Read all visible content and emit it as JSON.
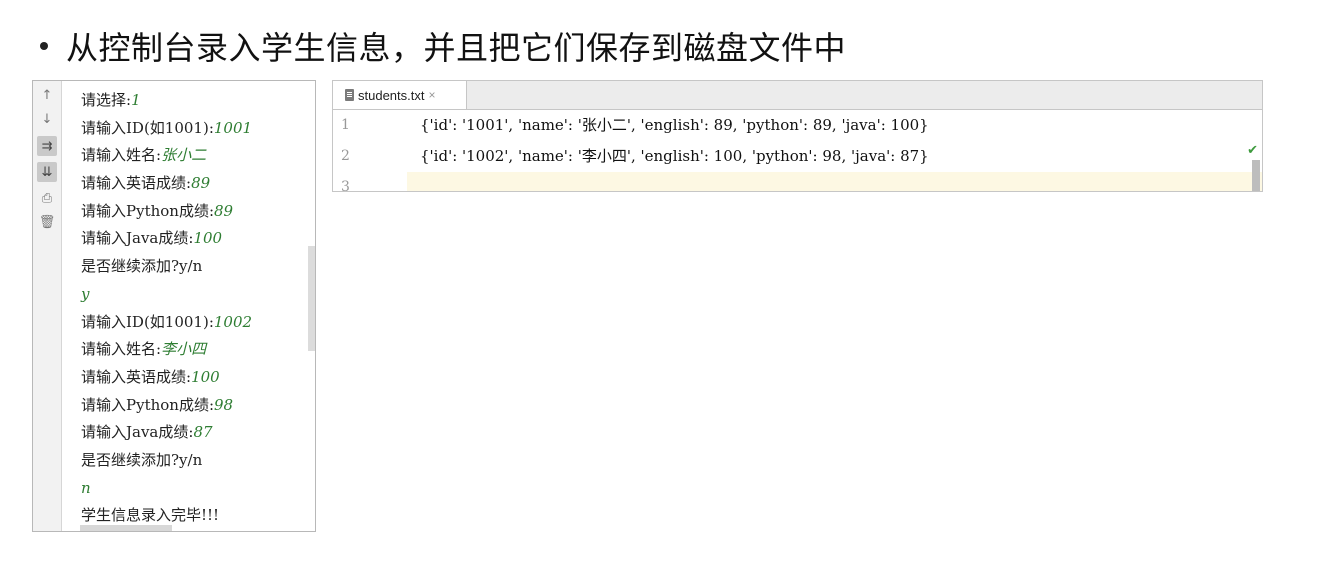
{
  "slide": {
    "title": "从控制台录入学生信息，并且把它们保存到磁盘文件中"
  },
  "console": {
    "toolbar": [
      {
        "name": "up-arrow-icon",
        "glyph": "↑"
      },
      {
        "name": "down-arrow-icon",
        "glyph": "↓"
      },
      {
        "name": "soft-wrap-icon",
        "glyph": "⇉"
      },
      {
        "name": "scroll-to-end-icon",
        "glyph": "⇊"
      },
      {
        "name": "print-icon",
        "glyph": "⎙"
      },
      {
        "name": "trash-icon",
        "glyph": "🗑"
      }
    ],
    "lines": [
      {
        "prompt": "请选择:",
        "input": "1"
      },
      {
        "prompt": "请输入ID(如1001):",
        "input": "1001"
      },
      {
        "prompt": "请输入姓名:",
        "input": "张小二"
      },
      {
        "prompt": "请输入英语成绩:",
        "input": "89"
      },
      {
        "prompt": "请输入Python成绩:",
        "input": "89"
      },
      {
        "prompt": "请输入Java成绩:",
        "input": "100"
      },
      {
        "prompt": "是否继续添加?y/n",
        "input": ""
      },
      {
        "prompt": "",
        "input": "y"
      },
      {
        "prompt": "请输入ID(如1001):",
        "input": "1002"
      },
      {
        "prompt": "请输入姓名:",
        "input": "李小四"
      },
      {
        "prompt": "请输入英语成绩:",
        "input": "100"
      },
      {
        "prompt": "请输入Python成绩:",
        "input": "98"
      },
      {
        "prompt": "请输入Java成绩:",
        "input": "87"
      },
      {
        "prompt": "是否继续添加?y/n",
        "input": ""
      },
      {
        "prompt": "",
        "input": "n"
      },
      {
        "prompt": "学生信息录入完毕!!!",
        "input": ""
      }
    ]
  },
  "editor": {
    "tab_label": "students.txt",
    "tab_close": "×",
    "lines": [
      {
        "num": "1",
        "text": "{'id': '1001', 'name': '张小二', 'english': 89, 'python': 89, 'java': 100}"
      },
      {
        "num": "2",
        "text": "{'id': '1002', 'name': '李小四', 'english': 100, 'python': 98, 'java': 87}"
      },
      {
        "num": "3",
        "text": ""
      }
    ],
    "status_icon": "checkmark-icon",
    "status_glyph": "✔",
    "colors": {
      "current_line": "#fdf8e3",
      "input_text": "#2e7d32"
    }
  }
}
